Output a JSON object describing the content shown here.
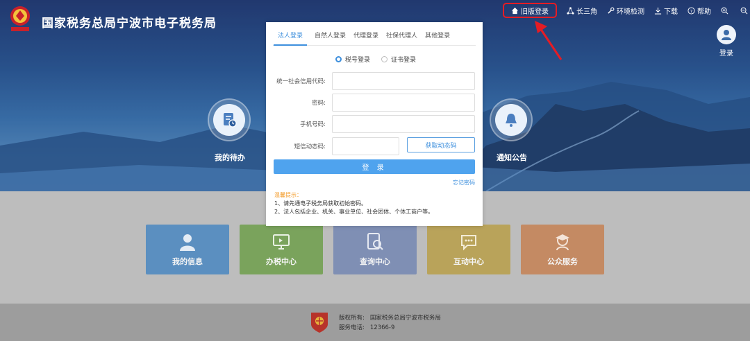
{
  "header": {
    "site_title": "国家税务总局宁波市电子税务局",
    "nav": {
      "old_login": "旧版登录",
      "yangtze": "长三角",
      "env_check": "环境检测",
      "download": "下载",
      "help": "帮助"
    },
    "user_login": "登录"
  },
  "hero": {
    "todo": "我的待办",
    "notice": "通知公告"
  },
  "login_modal": {
    "tabs": [
      "法人登录",
      "自然人登录",
      "代理登录",
      "社保代理人",
      "其他登录"
    ],
    "active_tab": 0,
    "radios": {
      "tax_id": "税号登录",
      "cert": "证书登录",
      "selected": "tax_id"
    },
    "fields": {
      "credit_code": {
        "label": "统一社会信用代码:",
        "value": ""
      },
      "password": {
        "label": "密码:",
        "value": ""
      },
      "phone": {
        "label": "手机号码:",
        "value": ""
      },
      "sms_code": {
        "label": "短信动态码:",
        "value": ""
      }
    },
    "sms_button": "获取动态码",
    "login_button": "登 录",
    "forgot_password": "忘记密码",
    "tips_title": "温馨提示：",
    "tips": [
      "1、请先通电子税务局获取初始密码。",
      "2、法人包括企业、机关、事业单位、社会团体、个体工商户等。"
    ]
  },
  "tiles": [
    {
      "label": "我的信息",
      "icon": "person-icon",
      "color": "#5b8fc0"
    },
    {
      "label": "办税中心",
      "icon": "monitor-icon",
      "color": "#7aa35c"
    },
    {
      "label": "查询中心",
      "icon": "search-doc-icon",
      "color": "#7f8fb4"
    },
    {
      "label": "互动中心",
      "icon": "chat-icon",
      "color": "#b9a35a"
    },
    {
      "label": "公众服务",
      "icon": "service-icon",
      "color": "#c48a63"
    }
  ],
  "footer": {
    "copyright_label": "版权所有:",
    "copyright_value": "国家税务总局宁波市税务局",
    "phone_label": "服务电话:",
    "phone_value": "12366-9"
  },
  "colors": {
    "accent": "#3d8fdd",
    "annotation_red": "#e51c24",
    "tip_orange": "#f39a26"
  }
}
